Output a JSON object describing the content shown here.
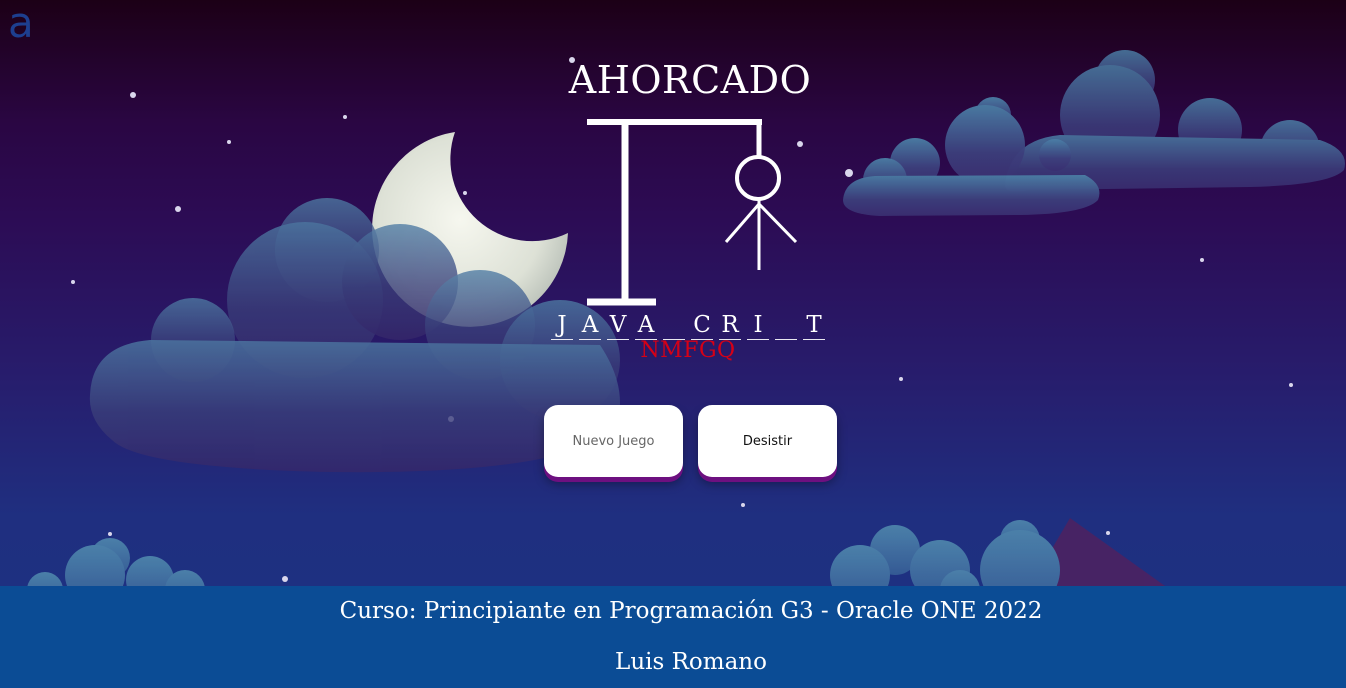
{
  "app": {
    "logo_glyph": "a",
    "title": "AHORCADO"
  },
  "game": {
    "letters": [
      "J",
      "A",
      "V",
      "A",
      "",
      "C",
      "R",
      "I",
      "",
      "T"
    ],
    "wrong_letters": "NMFGQ",
    "wrong_color": "#d60016"
  },
  "buttons": {
    "new_game": "Nuevo Juego",
    "give_up": "Desistir"
  },
  "footer": {
    "course": "Curso: Principiante en Programación G3 - Oracle ONE 2022",
    "author": "Luis Romano",
    "background": "#0b4c95"
  },
  "icons": {
    "logo": "alura-logo-icon",
    "moon": "crescent-moon-icon"
  }
}
